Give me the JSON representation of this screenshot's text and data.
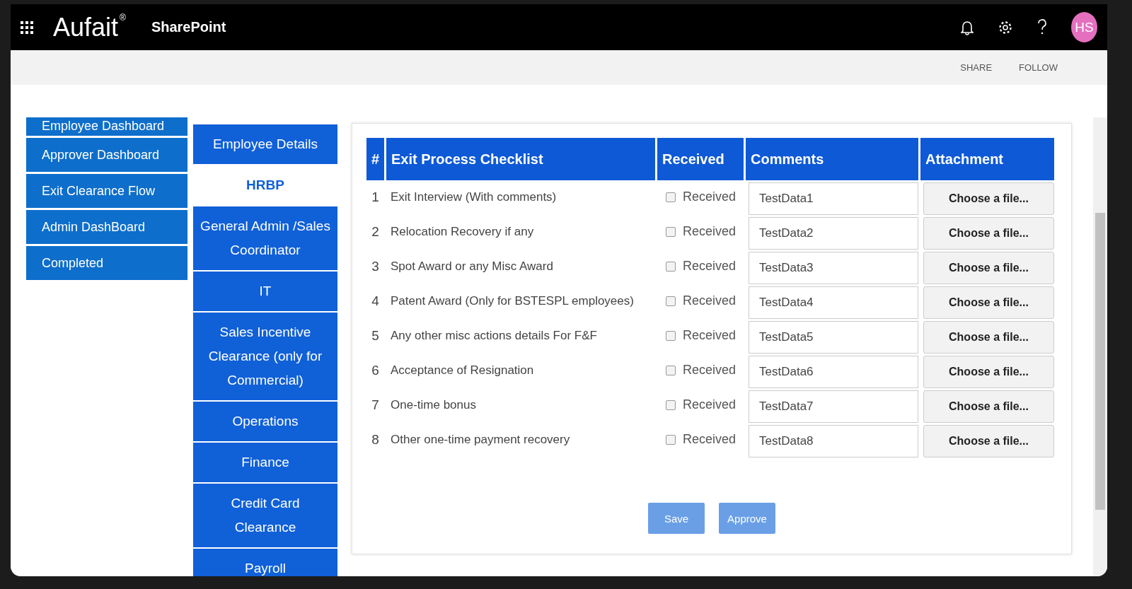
{
  "header": {
    "brand": "Aufait",
    "brand_mark": "®",
    "app": "SharePoint",
    "avatar": "HS"
  },
  "command_bar": [
    "SHARE",
    "FOLLOW"
  ],
  "left_nav": [
    {
      "label": "Employee Dashboard"
    },
    {
      "label": "Approver Dashboard"
    },
    {
      "label": "Exit Clearance Flow"
    },
    {
      "label": "Admin DashBoard"
    },
    {
      "label": "Completed"
    }
  ],
  "tabs": [
    {
      "label": "Employee Details",
      "selected": false
    },
    {
      "label": "HRBP",
      "selected": true
    },
    {
      "label": "General Admin /Sales Coordinator",
      "selected": false
    },
    {
      "label": "IT",
      "selected": false
    },
    {
      "label": "Sales Incentive Clearance (only for Commercial)",
      "selected": false
    },
    {
      "label": "Operations",
      "selected": false
    },
    {
      "label": "Finance",
      "selected": false
    },
    {
      "label": "Credit Card Clearance",
      "selected": false
    },
    {
      "label": "Payroll",
      "selected": false
    }
  ],
  "table": {
    "columns": [
      "#",
      "Exit Process Checklist",
      "Received",
      "Comments",
      "Attachment"
    ],
    "rows": [
      {
        "number": "1",
        "item": "Exit Interview (With comments)",
        "received_label": "Received",
        "checked": false,
        "comment": "TestData1",
        "attachment": "Choose a file..."
      },
      {
        "number": "2",
        "item": "Relocation Recovery if any",
        "received_label": "Received",
        "checked": false,
        "comment": "TestData2",
        "attachment": "Choose a file..."
      },
      {
        "number": "3",
        "item": "Spot Award or any Misc Award",
        "received_label": "Received",
        "checked": false,
        "comment": "TestData3",
        "attachment": "Choose a file..."
      },
      {
        "number": "4",
        "item": "Patent Award (Only for BSTESPL employees)",
        "received_label": "Received",
        "checked": false,
        "comment": "TestData4",
        "attachment": "Choose a file..."
      },
      {
        "number": "5",
        "item": "Any other misc actions details For F&F",
        "received_label": "Received",
        "checked": false,
        "comment": "TestData5",
        "attachment": "Choose a file..."
      },
      {
        "number": "6",
        "item": "Acceptance of Resignation",
        "received_label": "Received",
        "checked": false,
        "comment": "TestData6",
        "attachment": "Choose a file..."
      },
      {
        "number": "7",
        "item": "One-time bonus",
        "received_label": "Received",
        "checked": false,
        "comment": "TestData7",
        "attachment": "Choose a file..."
      },
      {
        "number": "8",
        "item": "Other one-time payment recovery",
        "received_label": "Received",
        "checked": false,
        "comment": "TestData8",
        "attachment": "Choose a file..."
      }
    ]
  },
  "buttons": [
    {
      "label": "Save",
      "disabled": true
    },
    {
      "label": "Approve",
      "disabled": true
    }
  ]
}
